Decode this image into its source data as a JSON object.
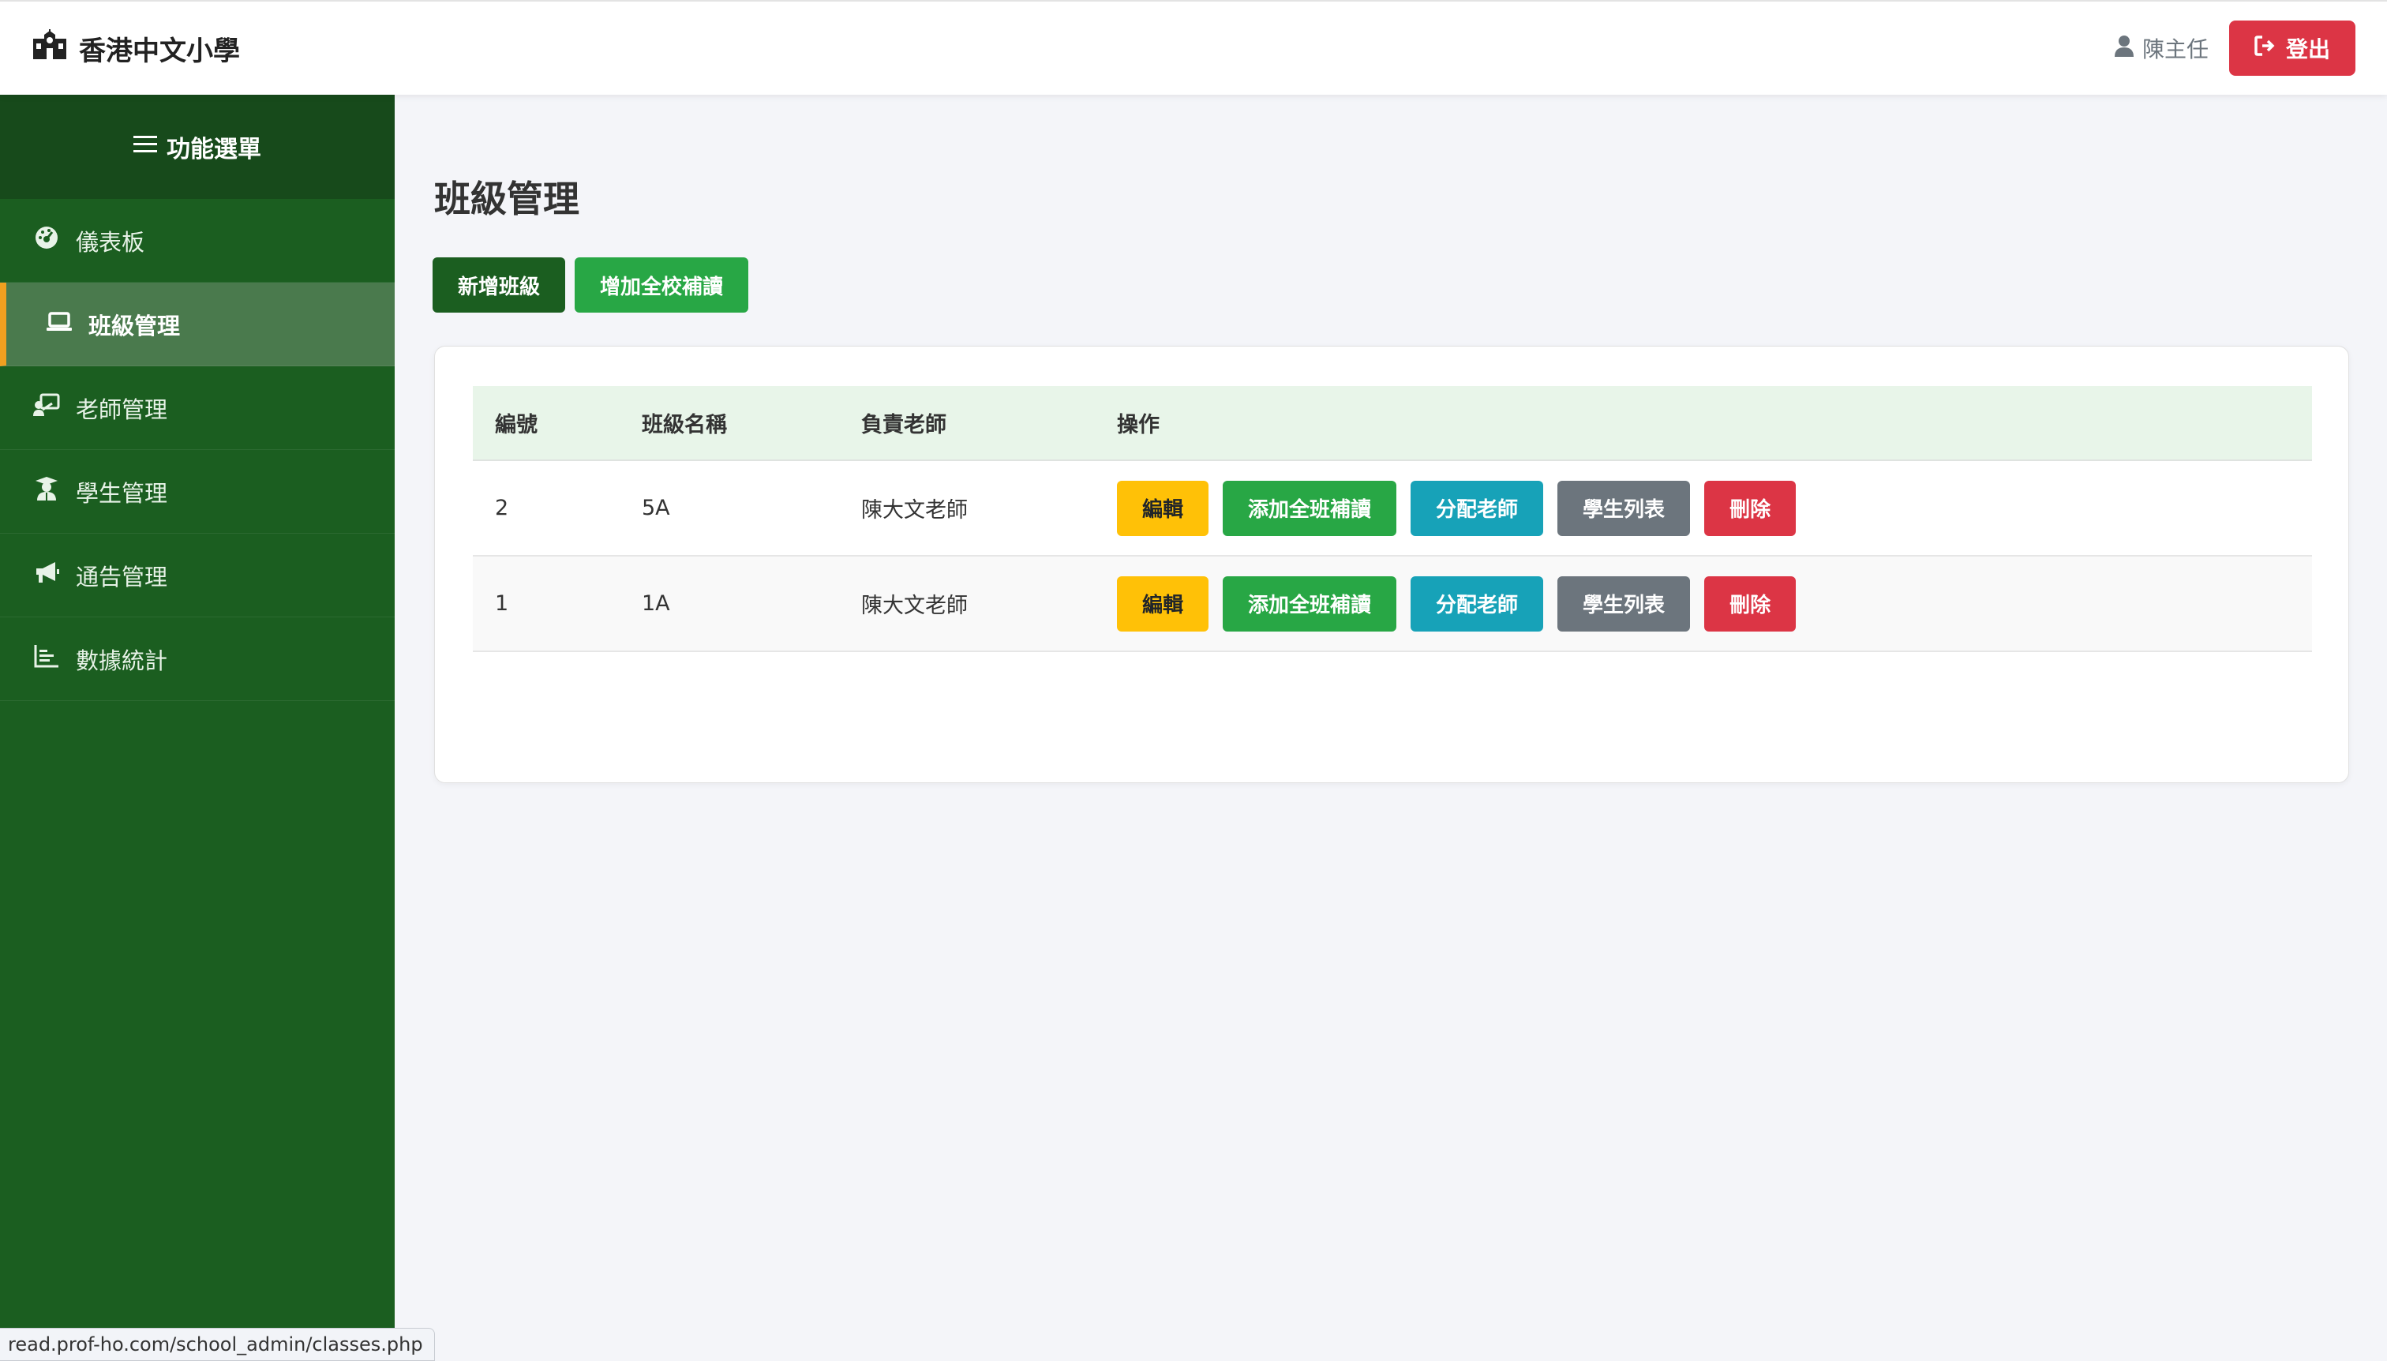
{
  "app": {
    "school_name": "香港中文小學"
  },
  "user": {
    "name": "陳主任"
  },
  "header": {
    "logout_label": "登出"
  },
  "sidebar": {
    "title": "功能選單",
    "items": [
      {
        "label": "儀表板",
        "icon": "dashboard-icon",
        "active": false
      },
      {
        "label": "班級管理",
        "icon": "laptop-icon",
        "active": true
      },
      {
        "label": "老師管理",
        "icon": "teacher-icon",
        "active": false
      },
      {
        "label": "學生管理",
        "icon": "student-icon",
        "active": false
      },
      {
        "label": "通告管理",
        "icon": "megaphone-icon",
        "active": false
      },
      {
        "label": "數據統計",
        "icon": "chart-icon",
        "active": false
      }
    ]
  },
  "main": {
    "page_title": "班級管理",
    "add_class_label": "新增班級",
    "add_school_remedial_label": "增加全校補讀",
    "table": {
      "headers": [
        "編號",
        "班級名稱",
        "負責老師",
        "操作"
      ],
      "rows": [
        {
          "id": "2",
          "class_name": "5A",
          "teacher": "陳大文老師"
        },
        {
          "id": "1",
          "class_name": "1A",
          "teacher": "陳大文老師"
        }
      ],
      "row_actions": {
        "edit": "編輯",
        "add_class_remedial": "添加全班補讀",
        "assign_teacher": "分配老師",
        "student_list": "學生列表",
        "delete": "刪除"
      }
    }
  },
  "status_bar": {
    "url": "read.prof-ho.com/school_admin/classes.php"
  },
  "colors": {
    "sidebar": "#1b5e20",
    "active_accent": "#f0a020",
    "danger": "#dc3545",
    "success": "#28a745",
    "warning": "#ffc107",
    "info": "#17a2b8",
    "secondary": "#6c757d"
  }
}
